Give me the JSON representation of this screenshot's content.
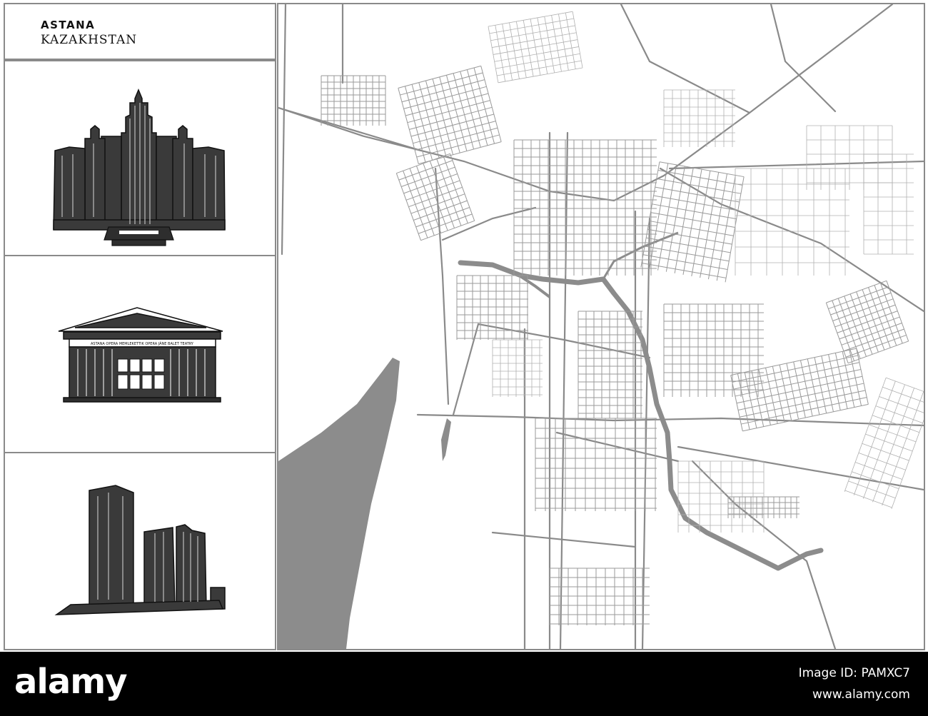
{
  "title": {
    "city": "ASTANA",
    "country": "KAZAKHSTAN"
  },
  "landmarks": [
    {
      "name": "skyscraper-complex-icon"
    },
    {
      "name": "opera-theatre-icon",
      "inscription": "ASTANA OPERA MEMLEKETTIK OPERA JÁNE BALET TEATRY"
    },
    {
      "name": "office-towers-icon"
    }
  ],
  "map": {
    "road_color": "#8a8a8a",
    "water_color": "#8c8c8c",
    "background": "#ffffff"
  },
  "watermark": {
    "brand": "alamy",
    "image_id": "Image ID: PAMXC7",
    "url": "www.alamy.com"
  }
}
